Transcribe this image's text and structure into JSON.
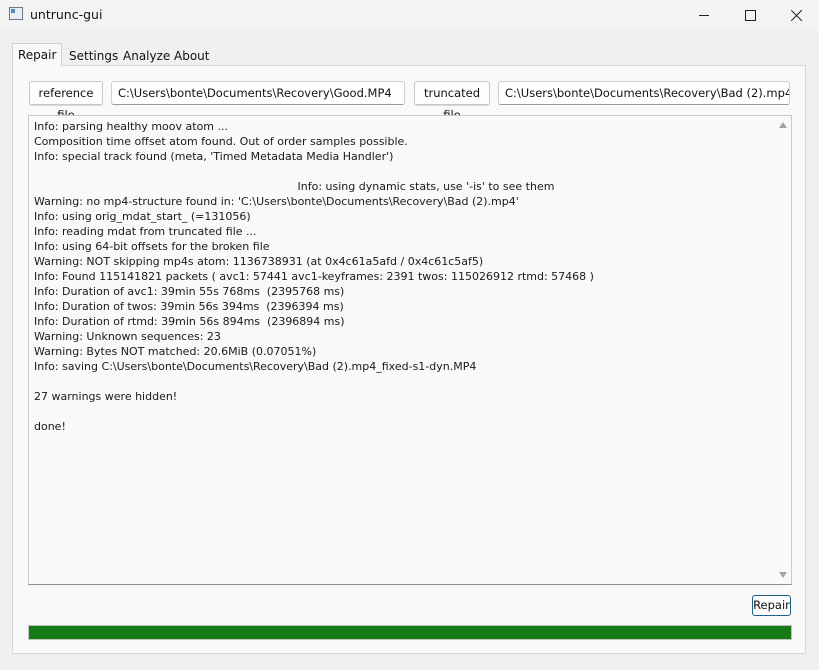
{
  "window": {
    "title": "untrunc-gui",
    "controls": [
      "minimize",
      "maximize",
      "close"
    ]
  },
  "tabs": [
    {
      "label": "Repair",
      "active": true
    },
    {
      "label": "Settings",
      "active": false
    },
    {
      "label": "Analyze",
      "active": false
    },
    {
      "label": "About",
      "active": false
    }
  ],
  "repair": {
    "reference_button": "reference file",
    "reference_path": "C:\\Users\\bonte\\Documents\\Recovery\\Good.MP4",
    "truncated_button": "truncated file",
    "truncated_path": "C:\\Users\\bonte\\Documents\\Recovery\\Bad (2).mp4",
    "log": [
      "Info: parsing healthy moov atom ...",
      "Composition time offset atom found. Out of order samples possible.",
      "Info: special track found (meta, 'Timed Metadata Media Handler')",
      "",
      "Info: using dynamic stats, use '-is' to see them",
      "Warning: no mp4-structure found in: 'C:\\Users\\bonte\\Documents\\Recovery\\Bad (2).mp4'",
      "Info: using orig_mdat_start_ (=131056)",
      "Info: reading mdat from truncated file ...",
      "Info: using 64-bit offsets for the broken file",
      "Warning: NOT skipping mp4s atom: 1136738931 (at 0x4c61a5afd / 0x4c61c5af5)",
      "Info: Found 115141821 packets ( avc1: 57441 avc1-keyframes: 2391 twos: 115026912 rtmd: 57468 )",
      "Info: Duration of avc1: 39min 55s 768ms  (2395768 ms)",
      "Info: Duration of twos: 39min 56s 394ms  (2396394 ms)",
      "Info: Duration of rtmd: 39min 56s 894ms  (2396894 ms)",
      "Warning: Unknown sequences: 23",
      "Warning: Bytes NOT matched: 20.6MiB (0.07051%)",
      "Info: saving C:\\Users\\bonte\\Documents\\Recovery\\Bad (2).mp4_fixed-s1-dyn.MP4",
      "",
      "27 warnings were hidden!",
      "",
      "done!"
    ],
    "centered_line_index": 4,
    "repair_button": "Repair",
    "progress_fraction": 1.0,
    "progress_color": "#167a16",
    "accent_color": "#1f5f8b"
  }
}
